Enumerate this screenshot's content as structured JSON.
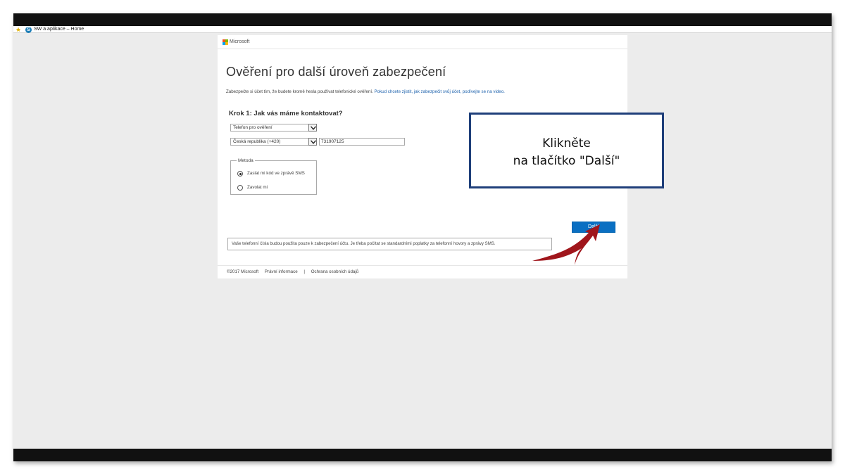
{
  "favorites_bar": {
    "item_label": "SW a aplikace – Home",
    "icons": [
      "favorites-star-icon",
      "sharepoint-icon"
    ]
  },
  "header": {
    "brand": "Microsoft",
    "logo_colors": [
      "#f25022",
      "#7fba00",
      "#00a4ef",
      "#ffb900"
    ]
  },
  "main": {
    "title": "Ověření pro další úroveň zabezpečení",
    "intro_text": "Zabezpečte si účet tím, že budete kromě hesla používat telefonické ověření.",
    "intro_link": "Pokud chcete zjistit, jak zabezpečit svůj účet, podívejte se na video.",
    "step_heading": "Krok 1: Jak vás máme kontaktovat?",
    "contact_type_selected": "Telefon pro ověření",
    "country_selected": "Česká republika (+420)",
    "phone_value": "731907125",
    "method": {
      "legend": "Metoda",
      "options": [
        {
          "label": "Zaslat mi kód ve zprávě SMS",
          "checked": true
        },
        {
          "label": "Zavolat mi",
          "checked": false
        }
      ]
    },
    "next_label": "Další",
    "notice": "Vaše telefonní čísla budou použita pouze k zabezpečení účtu. Je třeba počítat se standardními poplatky za telefonní hovory a zprávy SMS."
  },
  "footer": {
    "copyright": "©2017 Microsoft",
    "legal": "Právní informace",
    "separator": "|",
    "privacy": "Ochrana osobních údajů"
  },
  "callout": {
    "line1": "Klikněte",
    "line2": "na tlačítko \"Další\"",
    "border_color": "#1f3f7a",
    "arrow_color": "#a0161c"
  },
  "colors": {
    "accent_button": "#0a6fc2",
    "link": "#1f63ad"
  }
}
